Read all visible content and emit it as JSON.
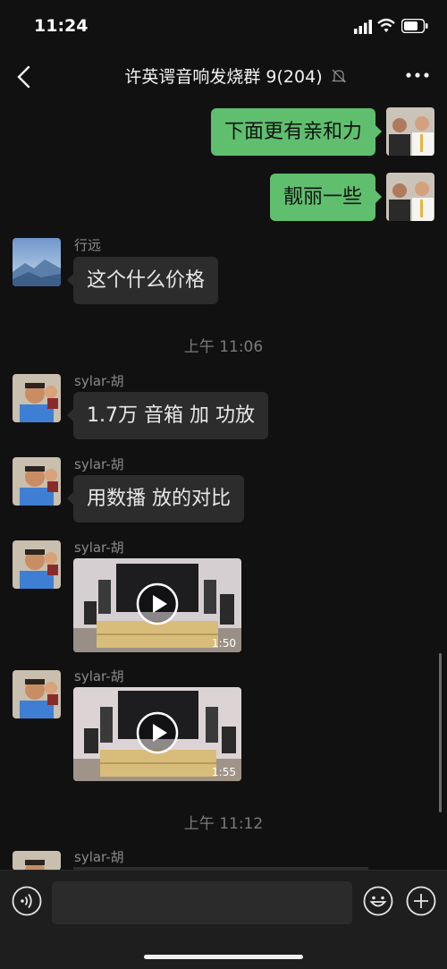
{
  "status_bar": {
    "time": "11:24"
  },
  "header": {
    "title": "许英谔音响发烧群 9(204)"
  },
  "messages": {
    "m1": {
      "text": "下面更有亲和力"
    },
    "m2": {
      "text": "靓丽一些"
    },
    "m3": {
      "sender": "行远",
      "text": "这个什么价格"
    },
    "ts1": "上午 11:06",
    "m4": {
      "sender": "sylar-胡",
      "text": "1.7万 音箱 加 功放"
    },
    "m5": {
      "sender": "sylar-胡",
      "text": "用数播 放的对比"
    },
    "m6": {
      "sender": "sylar-胡",
      "duration": "1:50"
    },
    "m7": {
      "sender": "sylar-胡",
      "duration": "1:55"
    },
    "ts2": "上午 11:12",
    "m8": {
      "sender": "sylar-胡"
    }
  },
  "colors": {
    "background": "#111111",
    "outgoing_bubble": "#5fbf6e",
    "incoming_bubble": "#2c2c2c"
  },
  "icons": [
    "back-icon",
    "mute-bell-icon",
    "more-icon",
    "signal-icon",
    "wifi-icon",
    "battery-icon",
    "voice-icon",
    "emoji-icon",
    "plus-icon",
    "play-icon"
  ]
}
